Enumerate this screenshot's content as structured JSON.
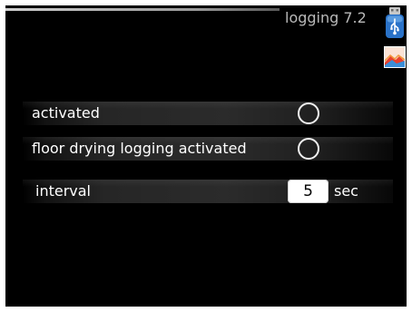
{
  "header": {
    "title": "logging 7.2",
    "icons": [
      "usb-icon",
      "image-icon"
    ]
  },
  "settings": {
    "activated": {
      "label": "activated",
      "checked": false
    },
    "floor_drying_logging": {
      "label": "floor drying logging activated",
      "checked": false
    },
    "interval": {
      "label": "interval",
      "value": "5",
      "unit": "sec"
    }
  },
  "colors": {
    "background": "#000000",
    "text": "#ffffff",
    "title_text": "#b9b9b9",
    "usb_icon_blue": "#2a72c8",
    "value_box": "#ffffff"
  }
}
